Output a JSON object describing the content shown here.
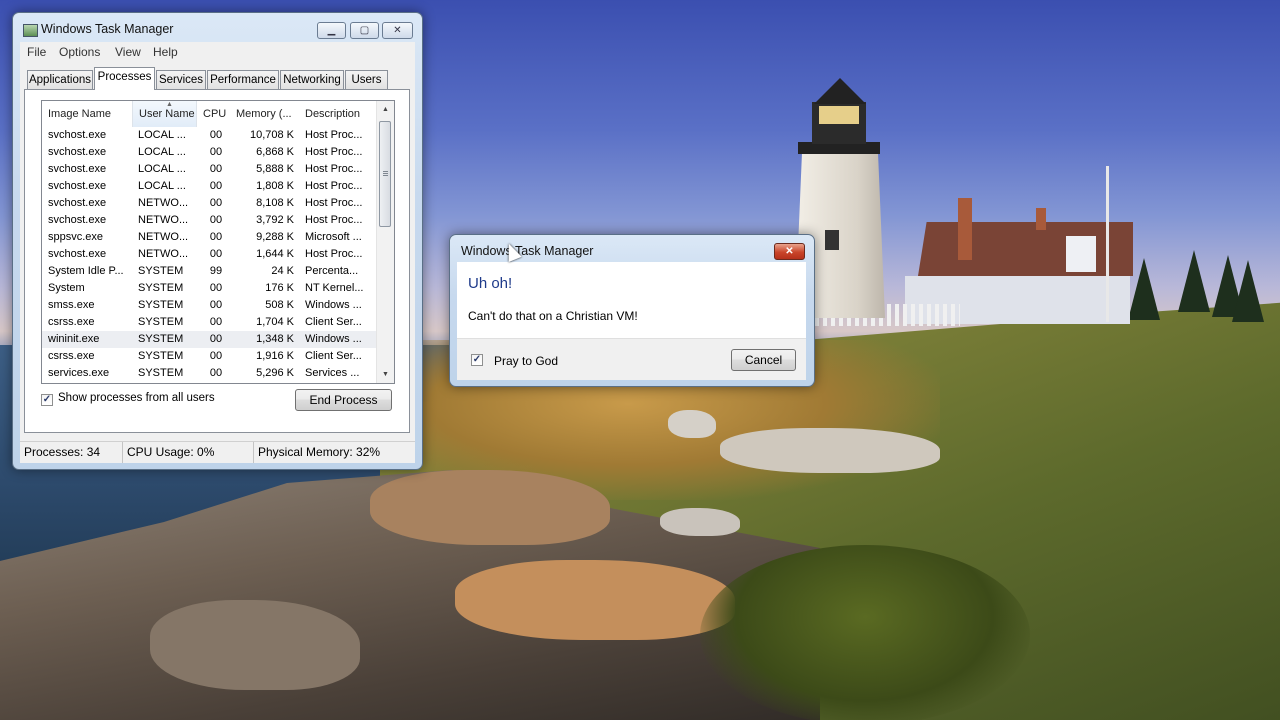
{
  "task_manager": {
    "title": "Windows Task Manager",
    "window_controls": {
      "minimize": "▁",
      "maximize": "▢",
      "close": "✕"
    },
    "menu": [
      "File",
      "Options",
      "View",
      "Help"
    ],
    "tabs": [
      "Applications",
      "Processes",
      "Services",
      "Performance",
      "Networking",
      "Users"
    ],
    "active_tab": "Processes",
    "columns": [
      "Image Name",
      "User Name",
      "CPU",
      "Memory (...",
      "Description"
    ],
    "sorted_column": "User Name",
    "rows": [
      {
        "image": "svchost.exe",
        "user": "LOCAL ...",
        "cpu": "00",
        "mem": "10,708 K",
        "desc": "Host Proc..."
      },
      {
        "image": "svchost.exe",
        "user": "LOCAL ...",
        "cpu": "00",
        "mem": "6,868 K",
        "desc": "Host Proc..."
      },
      {
        "image": "svchost.exe",
        "user": "LOCAL ...",
        "cpu": "00",
        "mem": "5,888 K",
        "desc": "Host Proc..."
      },
      {
        "image": "svchost.exe",
        "user": "LOCAL ...",
        "cpu": "00",
        "mem": "1,808 K",
        "desc": "Host Proc..."
      },
      {
        "image": "svchost.exe",
        "user": "NETWO...",
        "cpu": "00",
        "mem": "8,108 K",
        "desc": "Host Proc..."
      },
      {
        "image": "svchost.exe",
        "user": "NETWO...",
        "cpu": "00",
        "mem": "3,792 K",
        "desc": "Host Proc..."
      },
      {
        "image": "sppsvc.exe",
        "user": "NETWO...",
        "cpu": "00",
        "mem": "9,288 K",
        "desc": "Microsoft ..."
      },
      {
        "image": "svchost.exe",
        "user": "NETWO...",
        "cpu": "00",
        "mem": "1,644 K",
        "desc": "Host Proc..."
      },
      {
        "image": "System Idle P...",
        "user": "SYSTEM",
        "cpu": "99",
        "mem": "24 K",
        "desc": "Percenta..."
      },
      {
        "image": "System",
        "user": "SYSTEM",
        "cpu": "00",
        "mem": "176 K",
        "desc": "NT Kernel..."
      },
      {
        "image": "smss.exe",
        "user": "SYSTEM",
        "cpu": "00",
        "mem": "508 K",
        "desc": "Windows ..."
      },
      {
        "image": "csrss.exe",
        "user": "SYSTEM",
        "cpu": "00",
        "mem": "1,704 K",
        "desc": "Client Ser..."
      },
      {
        "image": "wininit.exe",
        "user": "SYSTEM",
        "cpu": "00",
        "mem": "1,348 K",
        "desc": "Windows ..."
      },
      {
        "image": "csrss.exe",
        "user": "SYSTEM",
        "cpu": "00",
        "mem": "1,916 K",
        "desc": "Client Ser..."
      },
      {
        "image": "services.exe",
        "user": "SYSTEM",
        "cpu": "00",
        "mem": "5,296 K",
        "desc": "Services ..."
      }
    ],
    "selected_row_index": 12,
    "show_all_users": {
      "label": "Show processes from all users",
      "checked": true,
      "mark": "✓"
    },
    "end_process_label": "End Process",
    "status": {
      "processes": "Processes: 34",
      "cpu": "CPU Usage: 0%",
      "memory": "Physical Memory: 32%"
    },
    "scrollbar": {
      "up": "▲",
      "down": "▼"
    }
  },
  "dialog": {
    "title": "Windows Task Manager",
    "close_glyph": "✕",
    "heading": "Uh oh!",
    "message": "Can't do that on a Christian VM!",
    "checkbox": {
      "label": "Pray to God",
      "checked": true,
      "mark": "✓"
    },
    "cancel_label": "Cancel"
  },
  "colors": {
    "dialog_heading": "#1e3a8a",
    "close_button": "#c9452a",
    "selected_row": "#eceef2"
  }
}
